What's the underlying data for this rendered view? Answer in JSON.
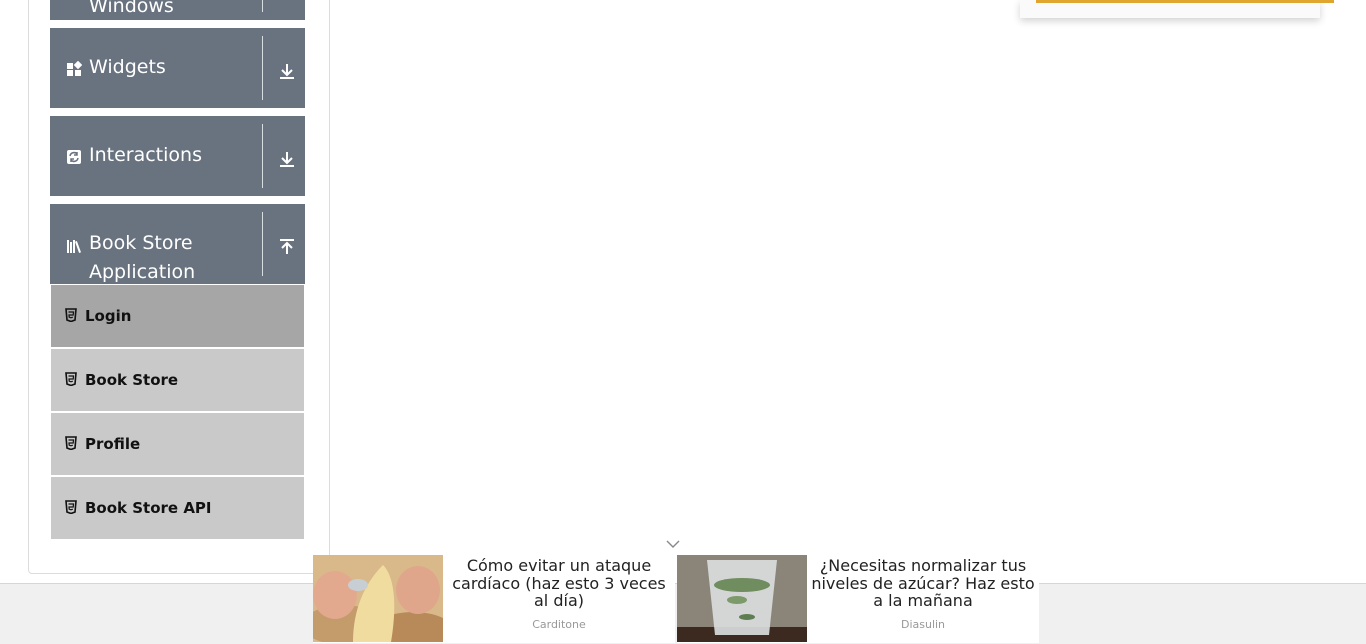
{
  "sidebar": {
    "groups": [
      {
        "label": "Windows",
        "icon": "window-icon",
        "arrow": "download-icon"
      },
      {
        "label": "Widgets",
        "icon": "widgets-icon",
        "arrow": "download-icon"
      },
      {
        "label": "Interactions",
        "icon": "interactions-icon",
        "arrow": "download-icon"
      },
      {
        "label_line1": "Book Store",
        "label_line2": "Application",
        "icon": "book-store-icon",
        "arrow": "upload-icon"
      }
    ],
    "book_store_items": [
      {
        "label": "Login",
        "active": true
      },
      {
        "label": "Book Store",
        "active": false
      },
      {
        "label": "Profile",
        "active": false
      },
      {
        "label": "Book Store API",
        "active": false
      }
    ]
  },
  "ads": [
    {
      "text": "Cómo evitar un ataque cardíaco (haz esto 3 veces al día)",
      "source": "Carditone"
    },
    {
      "text": "¿Necesitas normalizar tus niveles de azúcar? Haz esto a la mañana",
      "source": "Diasulin"
    }
  ],
  "colors": {
    "group_header_bg": "#69737f",
    "sub_item_bg": "#c9c9c9",
    "sub_item_active_bg": "#a6a6a6",
    "ad_stripe": "#e0a52f"
  }
}
